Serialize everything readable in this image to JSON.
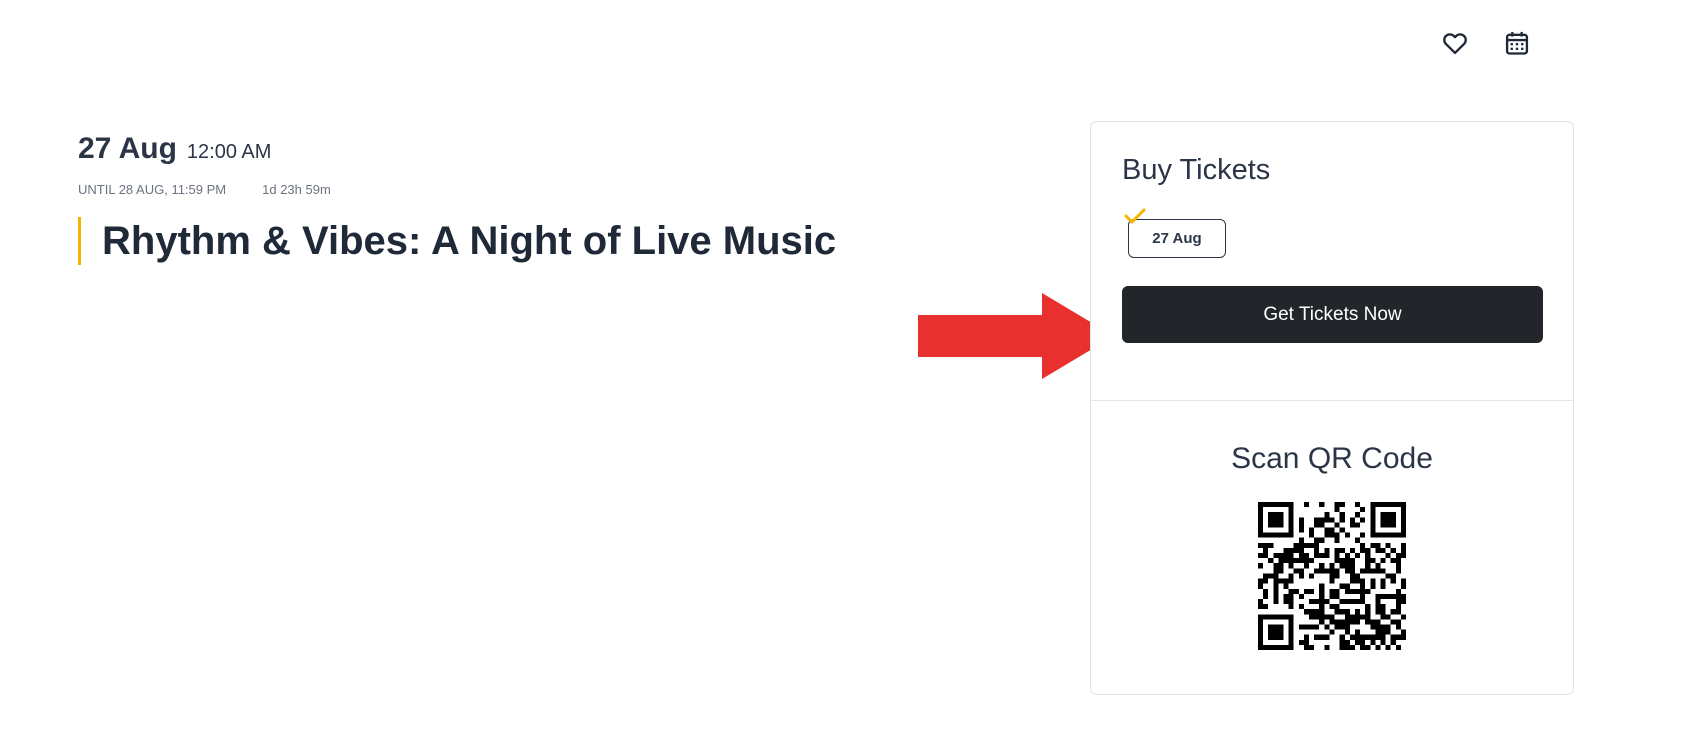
{
  "header": {
    "icons": [
      "heart-icon",
      "calendar-icon"
    ]
  },
  "event": {
    "date": "27 Aug",
    "time": "12:00 AM",
    "until": "UNTIL 28 AUG, 11:59 PM",
    "countdown": "1d 23h 59m",
    "title": "Rhythm & Vibes: A Night of Live Music",
    "accent_color": "#f5b400"
  },
  "tickets": {
    "heading": "Buy Tickets",
    "selected_date": "27 Aug",
    "cta_label": "Get Tickets Now",
    "cta_color": "#22252a"
  },
  "qr": {
    "heading": "Scan QR Code"
  },
  "annotation": {
    "arrow_color": "#e8312f"
  }
}
